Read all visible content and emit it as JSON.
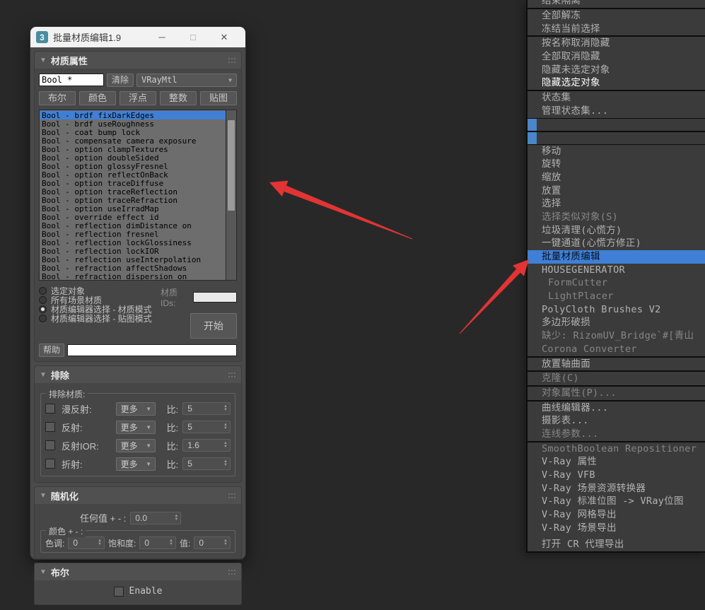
{
  "colors": {
    "highlight_blue": "#3f80d6",
    "arrow_red": "#e23434",
    "app_icon_teal": "#4a8ca0",
    "titlebar_bg": "#f2f2f2",
    "dialog_bg": "#4a4a4a",
    "menu_bg": "#3b3b3b"
  },
  "dialog": {
    "title": "批量材质编辑1.9",
    "icon_label": "3",
    "titlebar_buttons": {
      "minimize": "─",
      "maximize": "□",
      "close": "✕"
    },
    "material_props": {
      "title": "材质属性",
      "filter_value": "Bool *",
      "clear_button": "清除",
      "type_dropdown": "VRayMtl",
      "type_buttons": [
        "布尔",
        "颜色",
        "浮点",
        "整数",
        "贴图"
      ],
      "property_list": [
        "Bool - brdf_fixDarkEdges",
        "Bool - brdf_useRoughness",
        "Bool - coat_bump_lock",
        "Bool - compensate_camera_exposure",
        "Bool - option_clampTextures",
        "Bool - option_doubleSided",
        "Bool - option_glossyFresnel",
        "Bool - option_reflectOnBack",
        "Bool - option_traceDiffuse",
        "Bool - option_traceReflection",
        "Bool - option_traceRefraction",
        "Bool - option_useIrradMap",
        "Bool - override_effect_id",
        "Bool - reflection_dimDistance_on",
        "Bool - reflection_fresnel",
        "Bool - reflection_lockGlossiness",
        "Bool - reflection_lockIOR",
        "Bool - reflection_useInterpolation",
        "Bool - refraction_affectShadows",
        "Bool - refraction_dispersion_on"
      ],
      "radios": [
        "选定对象",
        "所有场景材质",
        "材质编辑器选择 - 材质模式",
        "材质编辑器选择 - 贴图模式"
      ],
      "material_ids_label": "材质IDs:",
      "material_ids_value": "",
      "start_button": "开始",
      "help_button": "帮助",
      "help_value": ""
    },
    "exclude": {
      "title": "排除",
      "group_label": "排除材质:",
      "more_label": "更多",
      "ratio_label": "比:",
      "rows": [
        {
          "label": "漫反射:",
          "value": "5"
        },
        {
          "label": "反射:",
          "value": "5"
        },
        {
          "label": "反射IOR:",
          "value": "1.6"
        },
        {
          "label": "折射:",
          "value": "5"
        }
      ]
    },
    "randomize": {
      "title": "随机化",
      "any_value_label": "任何值 + - :",
      "any_value": "0.0",
      "color_group_label": "颜色 + - :",
      "hue_label": "色调:",
      "hue_value": "0",
      "saturation_label": "饱和度:",
      "saturation_value": "0",
      "value_label": "值:",
      "value_value": "0"
    },
    "bool": {
      "title": "布尔",
      "enable_label": "Enable"
    }
  },
  "menu": {
    "items": [
      "结束隔离",
      "全部解冻",
      "冻结当前选择",
      "按名称取消隐藏",
      "全部取消隐藏",
      "隐藏未选定对象",
      "隐藏选定对象",
      "状态集",
      "管理状态集...",
      "移动",
      "旋转",
      "缩放",
      "放置",
      "选择",
      "选择类似对象(S)",
      "垃圾清理(心慌方)",
      "一键通道(心慌方修正)",
      "批量材质编辑",
      "HOUSEGENERATOR",
      "FormCutter",
      "LightPlacer",
      "PolyCloth Brushes V2",
      "多边形破损",
      "缺少: RizomUV_Bridge`#[青山",
      "Corona Converter",
      "放置轴曲面",
      "克隆(C)",
      "对象属性(P)...",
      "曲线编辑器...",
      "摄影表...",
      "连线参数...",
      "SmoothBoolean Repositioner",
      "V-Ray 属性",
      "V-Ray VFB",
      "V-Ray 场景资源转换器",
      "V-Ray 标准位图 -> VRay位图",
      "V-Ray 网格导出",
      "V-Ray 场景导出",
      "打开 CR 代理导出"
    ]
  }
}
